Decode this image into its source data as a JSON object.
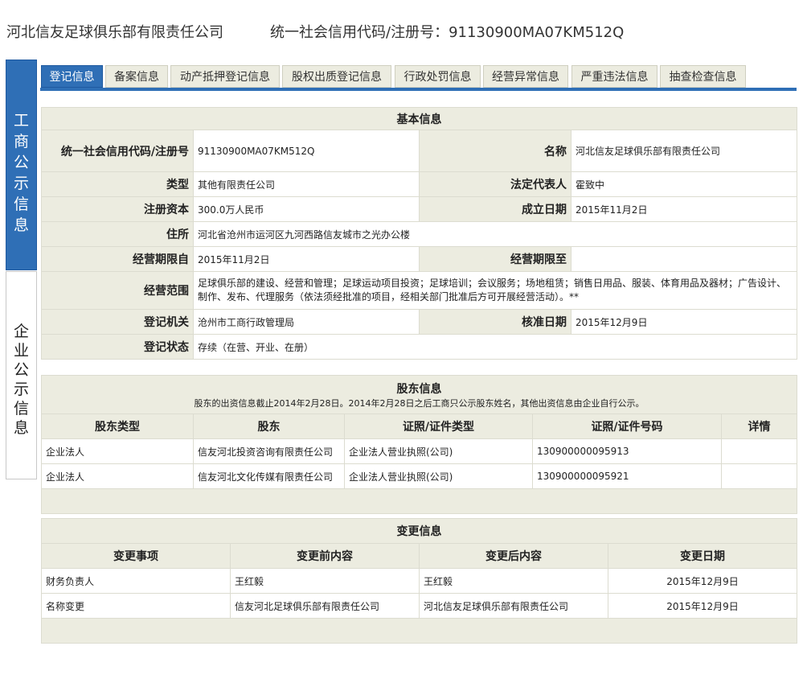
{
  "header": {
    "company_name": "河北信友足球俱乐部有限责任公司",
    "credit_code_text": "统一社会信用代码/注册号：91130900MA07KM512Q"
  },
  "sidebar": {
    "top_label": [
      "工",
      "商",
      "公",
      "示",
      "信",
      "息"
    ],
    "bottom_label": [
      "企",
      "业",
      "公",
      "示",
      "信",
      "息"
    ]
  },
  "tabs": [
    {
      "label": "登记信息",
      "active": true
    },
    {
      "label": "备案信息"
    },
    {
      "label": "动产抵押登记信息"
    },
    {
      "label": "股权出质登记信息"
    },
    {
      "label": "行政处罚信息"
    },
    {
      "label": "经营异常信息"
    },
    {
      "label": "严重违法信息"
    },
    {
      "label": "抽查检查信息"
    }
  ],
  "basic": {
    "title": "基本信息",
    "credit_code_label": "统一社会信用代码/注册号",
    "credit_code": "91130900MA07KM512Q",
    "name_label": "名称",
    "name": "河北信友足球俱乐部有限责任公司",
    "type_label": "类型",
    "type": "其他有限责任公司",
    "legal_rep_label": "法定代表人",
    "legal_rep": "霍致中",
    "capital_label": "注册资本",
    "capital": "300.0万人民币",
    "established_label": "成立日期",
    "established": "2015年11月2日",
    "address_label": "住所",
    "address": "河北省沧州市运河区九河西路信友城市之光办公楼",
    "term_from_label": "经营期限自",
    "term_from": "2015年11月2日",
    "term_to_label": "经营期限至",
    "term_to": "",
    "scope_label": "经营范围",
    "scope": "足球俱乐部的建设、经营和管理；足球运动项目投资；足球培训；会议服务；场地租赁；销售日用品、服装、体育用品及器材；广告设计、制作、发布、代理服务（依法须经批准的项目，经相关部门批准后方可开展经营活动）。**",
    "authority_label": "登记机关",
    "authority": "沧州市工商行政管理局",
    "approval_label": "核准日期",
    "approval": "2015年12月9日",
    "status_label": "登记状态",
    "status": "存续（在营、开业、在册）"
  },
  "shareholders": {
    "title": "股东信息",
    "note": "股东的出资信息截止2014年2月28日。2014年2月28日之后工商只公示股东姓名，其他出资信息由企业自行公示。",
    "headers": [
      "股东类型",
      "股东",
      "证照/证件类型",
      "证照/证件号码",
      "详情"
    ],
    "rows": [
      [
        "企业法人",
        "信友河北投资咨询有限责任公司",
        "企业法人营业执照(公司)",
        "130900000095913",
        ""
      ],
      [
        "企业法人",
        "信友河北文化传媒有限责任公司",
        "企业法人营业执照(公司)",
        "130900000095921",
        ""
      ]
    ]
  },
  "changes": {
    "title": "变更信息",
    "headers": [
      "变更事项",
      "变更前内容",
      "变更后内容",
      "变更日期"
    ],
    "rows": [
      [
        "财务负责人",
        "王红毅",
        "王红毅",
        "2015年12月9日"
      ],
      [
        "名称变更",
        "信友河北足球俱乐部有限责任公司",
        "河北信友足球俱乐部有限责任公司",
        "2015年12月9日"
      ]
    ]
  }
}
